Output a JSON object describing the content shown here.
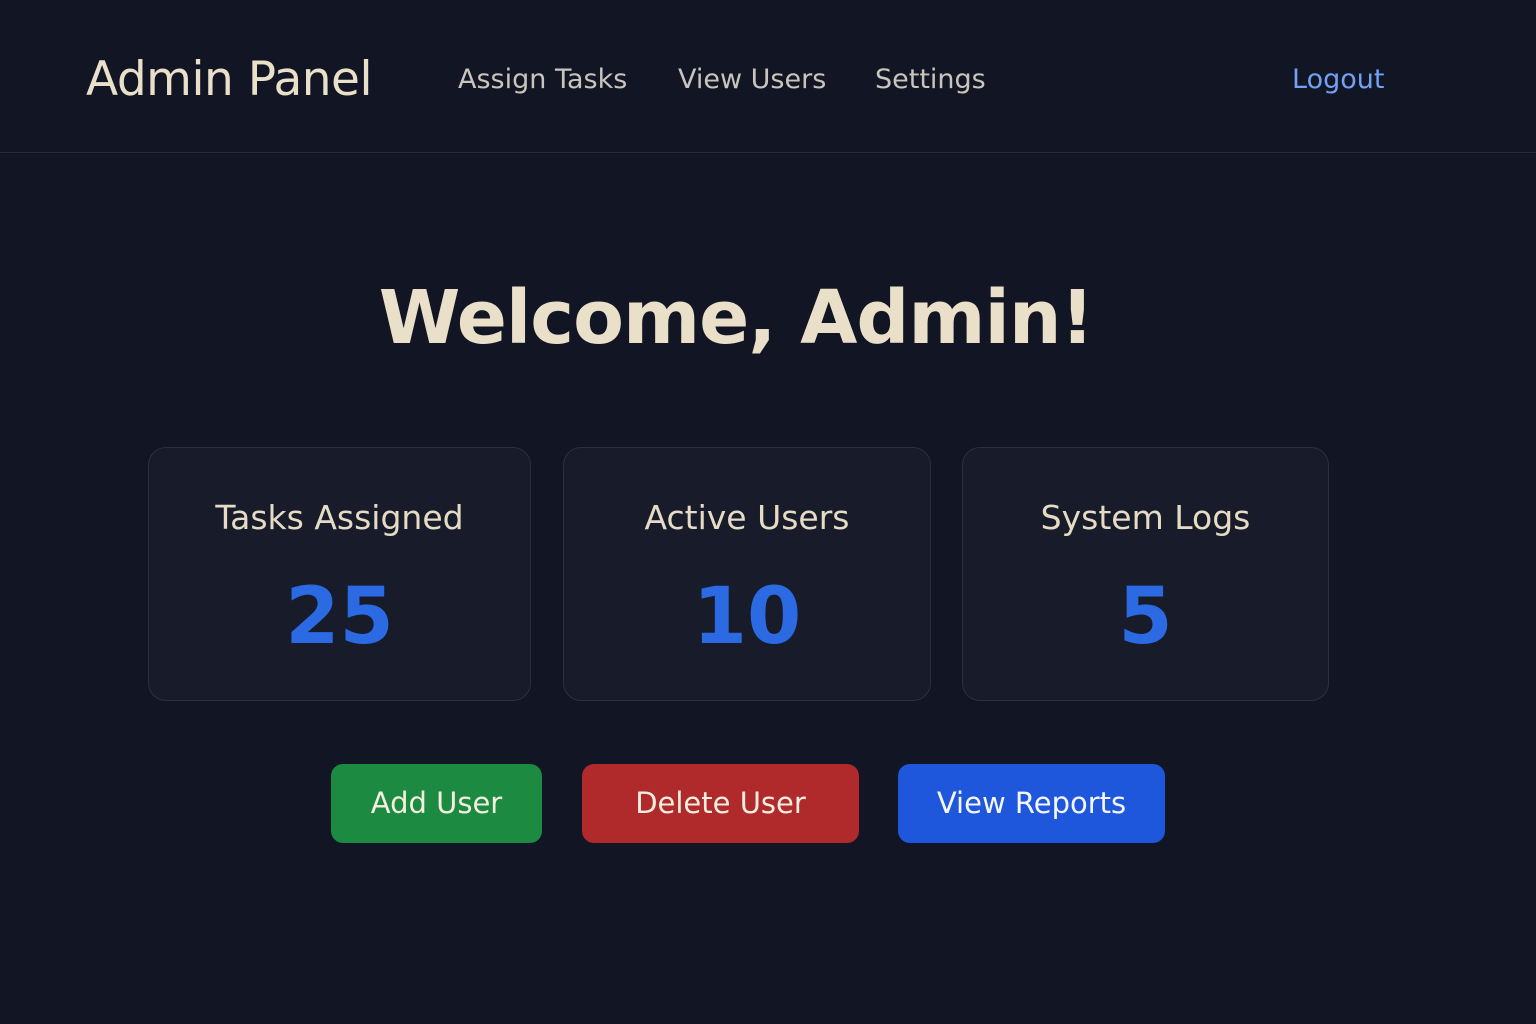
{
  "header": {
    "brand": "Admin Panel",
    "nav": [
      "Assign Tasks",
      "View Users",
      "Settings"
    ],
    "logout": "Logout"
  },
  "main": {
    "welcome": "Welcome, Admin!",
    "stats": [
      {
        "label": "Tasks Assigned",
        "value": "25"
      },
      {
        "label": "Active Users",
        "value": "10"
      },
      {
        "label": "System Logs",
        "value": "5"
      }
    ],
    "actions": {
      "add_user": "Add User",
      "delete_user": "Delete User",
      "view_reports": "View Reports"
    }
  },
  "colors": {
    "background": "#121624",
    "card": "#171b2a",
    "text_primary": "#eadfc8",
    "nav_text": "#c9c5bd",
    "logout": "#72a0f3",
    "stat_value": "#2b6ae3",
    "add_button": "#1c8a41",
    "delete_button": "#b02a2c",
    "reports_button": "#1f57dc"
  }
}
